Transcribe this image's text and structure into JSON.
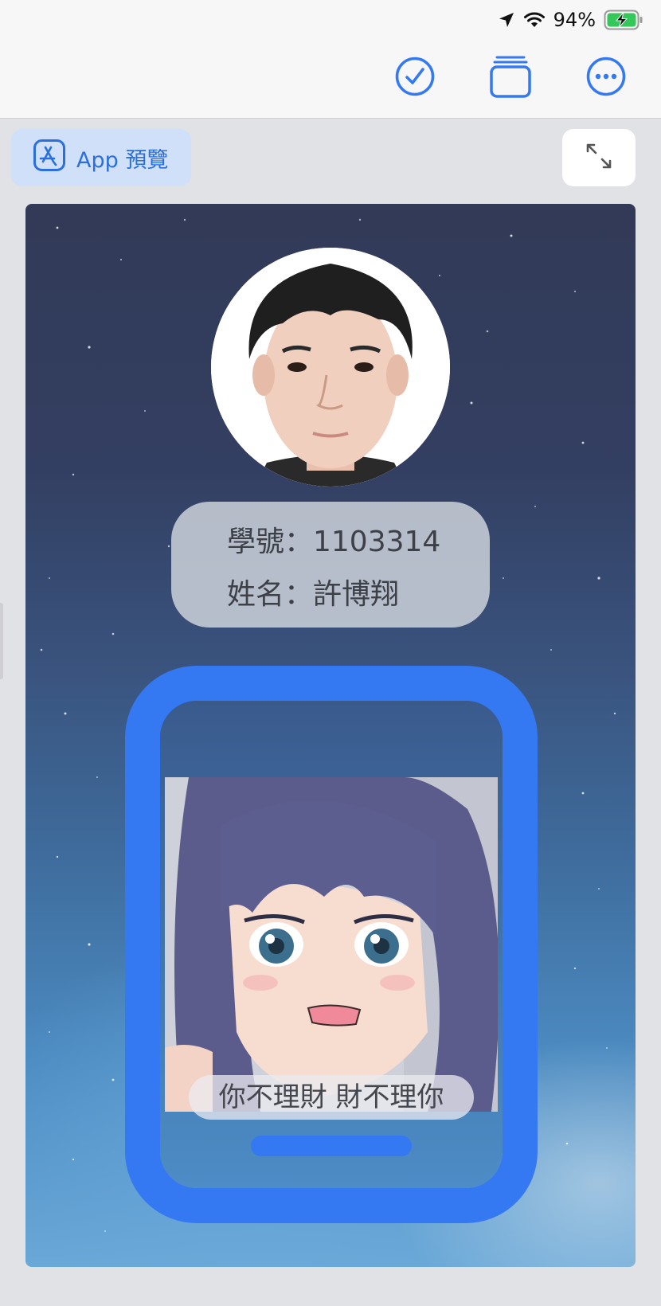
{
  "status_bar": {
    "battery_percent": "94%",
    "icons": [
      "location-arrow-icon",
      "wifi-icon",
      "battery-charging-icon"
    ]
  },
  "toolbar": {
    "icons": [
      "checkmark-circle-icon",
      "stack-icon",
      "more-circle-icon"
    ],
    "accent_color": "#3478f2"
  },
  "preview": {
    "app_preview_label": "App 預覽",
    "app_preview_icon": "app-store-icon",
    "expand_icon": "expand-arrows-icon"
  },
  "profile": {
    "student_id_line": "學號：1103314",
    "name_line": "姓名：許博翔"
  },
  "phone_card": {
    "caption": "你不理財 財不理你",
    "frame_color": "#3478f2"
  }
}
